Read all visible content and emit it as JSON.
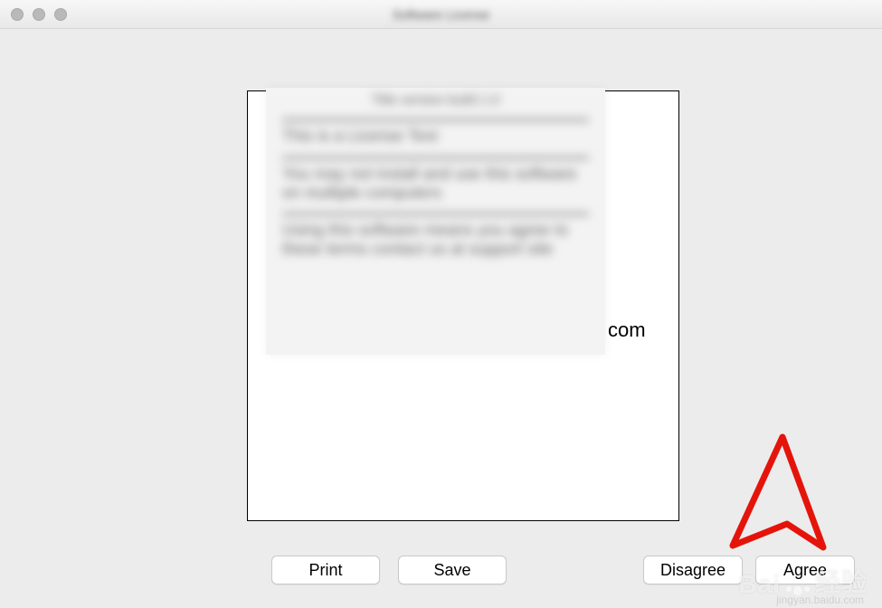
{
  "titlebar": {
    "title": "Software License"
  },
  "document": {
    "visible_fragment": "com",
    "blurred_heading": "Title\nversion\nbuild 1.0",
    "blurred_line1": "This is a License Text",
    "blurred_line2": "You may not install and use this software on multiple computers",
    "blurred_line3": "Using this software means you agree to these terms contact us at support site"
  },
  "buttons": {
    "print": "Print",
    "save": "Save",
    "disagree": "Disagree",
    "agree": "Agree"
  },
  "watermark": {
    "brand": "Bai",
    "brand2": "经验",
    "sub": "jingyan.baidu.com"
  }
}
